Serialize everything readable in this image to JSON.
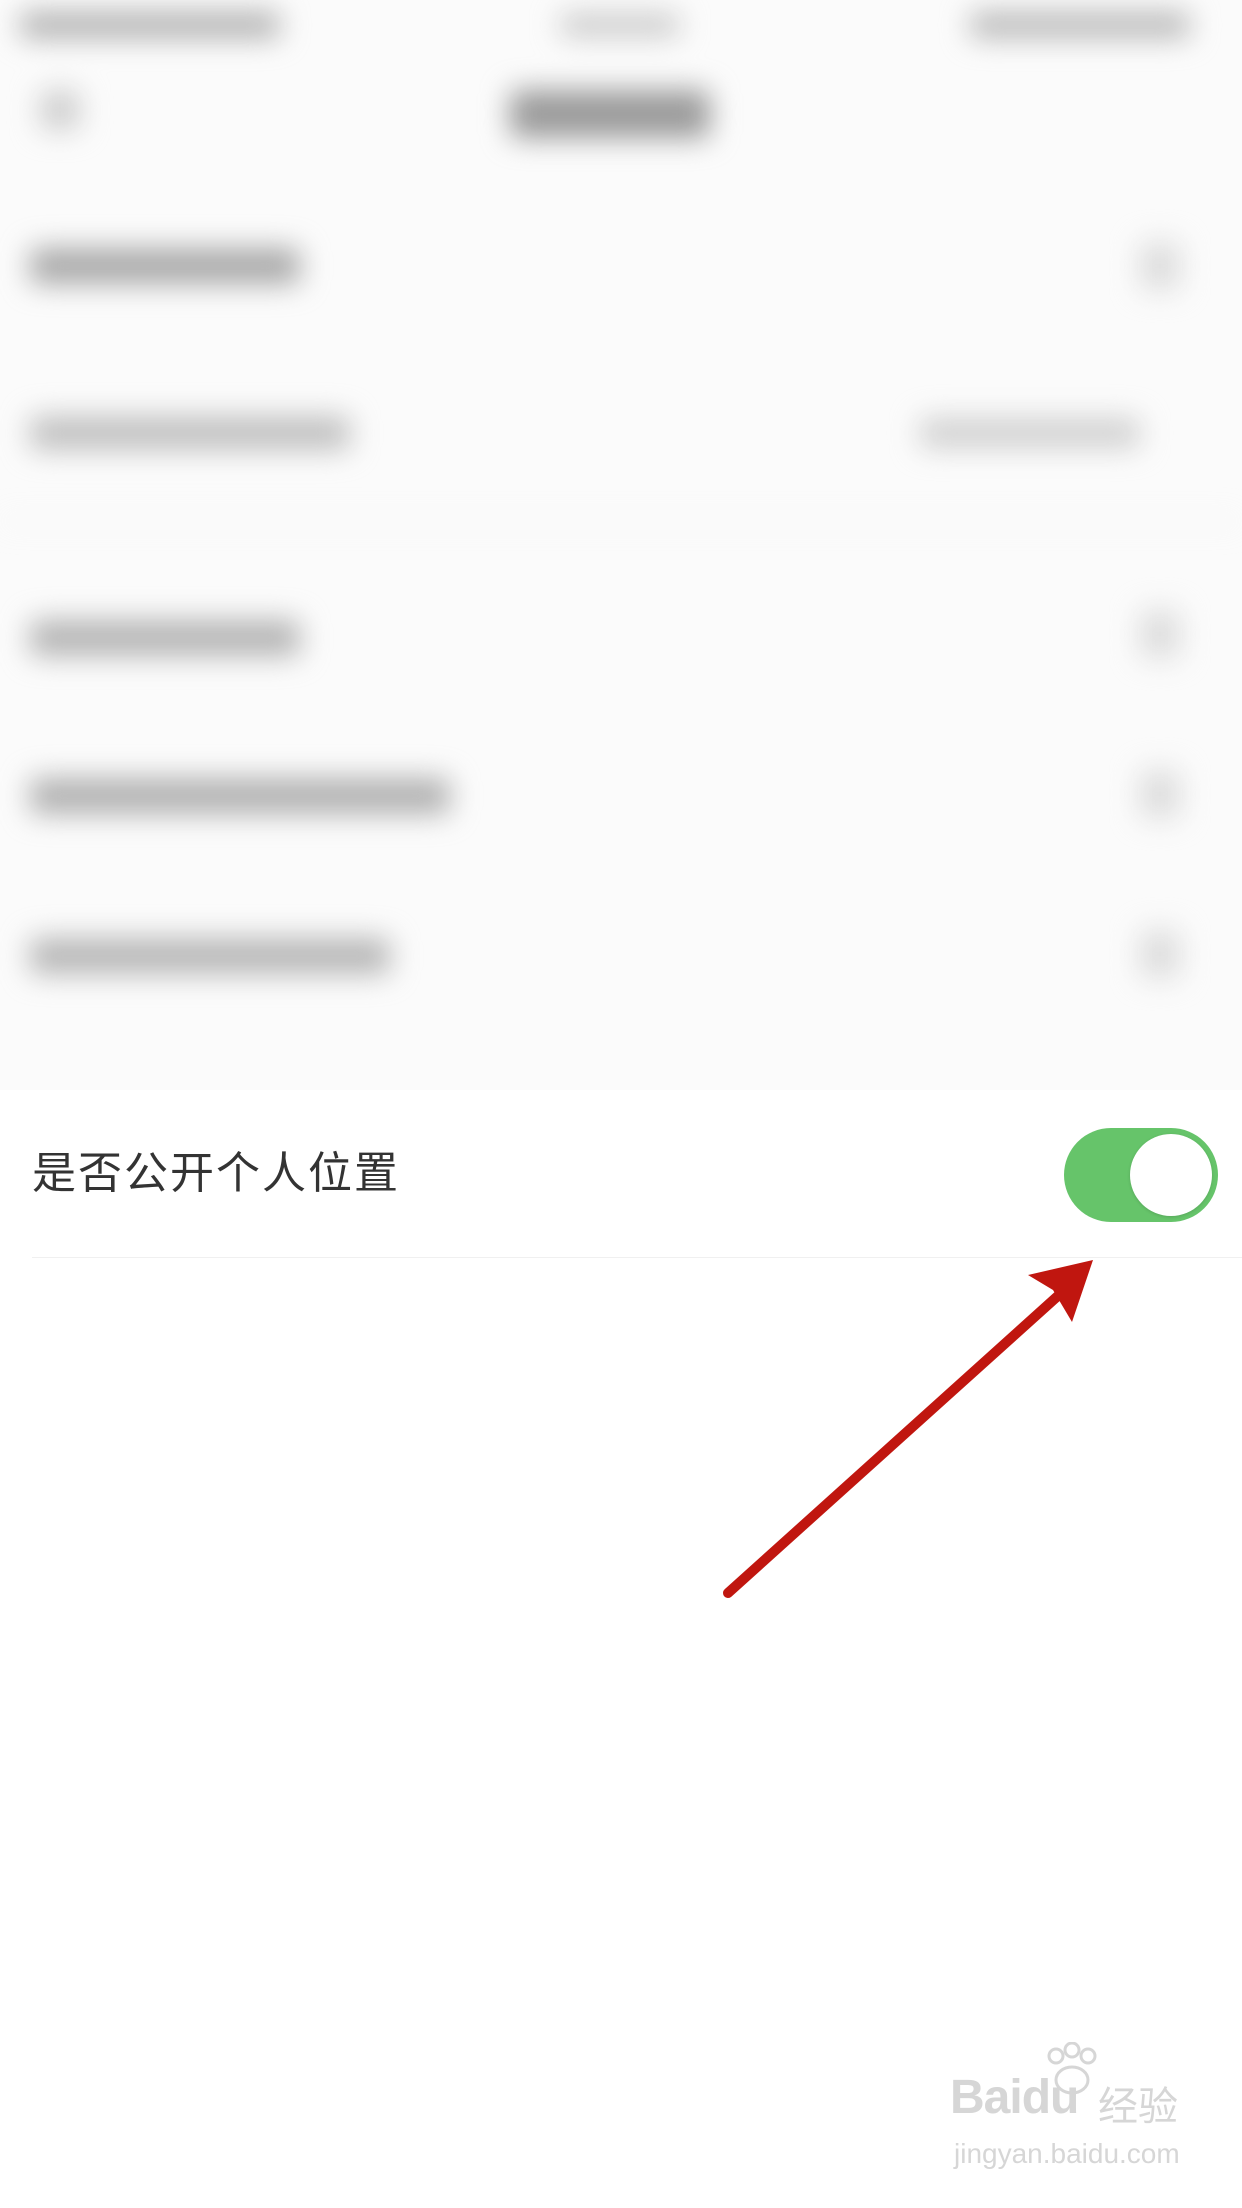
{
  "settings": {
    "public_location_label": "是否公开个人位置",
    "public_location_enabled": true,
    "toggle_on_color": "#66c46a"
  },
  "annotation": {
    "arrow_color": "#c0160f"
  },
  "watermark": {
    "brand": "Baidu",
    "product": "经验",
    "url": "jingyan.baidu.com",
    "paw_icon": "baidu-paw-icon"
  }
}
